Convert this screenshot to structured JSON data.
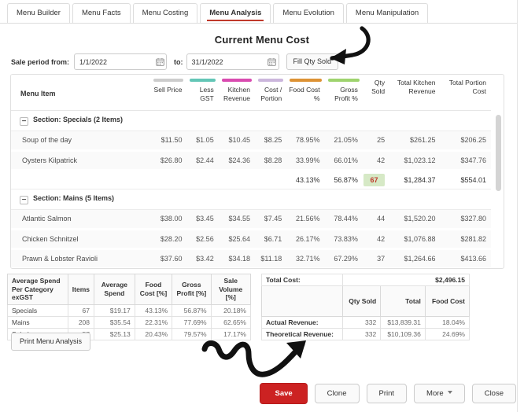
{
  "tabs": [
    {
      "label": "Menu Builder",
      "active": false
    },
    {
      "label": "Menu Facts",
      "active": false
    },
    {
      "label": "Menu Costing",
      "active": false
    },
    {
      "label": "Menu Analysis",
      "active": true
    },
    {
      "label": "Menu Evolution",
      "active": false
    },
    {
      "label": "Menu Manipulation",
      "active": false
    }
  ],
  "page_title": "Current Menu Cost",
  "filters": {
    "from_label": "Sale period from:",
    "from_value": "1/1/2022",
    "to_label": "to:",
    "to_value": "31/1/2022",
    "fill_qty_label": "Fill Qty Sold",
    "calendar_icon": "calendar-icon"
  },
  "grid": {
    "columns": [
      {
        "label": "Menu Item",
        "bar": ""
      },
      {
        "label": "Sell Price",
        "bar": "#cccccc"
      },
      {
        "label": "Less GST",
        "bar": "#63c6b6"
      },
      {
        "label": "Kitchen Revenue",
        "bar": "#d94bb0"
      },
      {
        "label": "Cost / Portion",
        "bar": "#cbb6dc"
      },
      {
        "label": "Food Cost %",
        "bar": "#dd9234"
      },
      {
        "label": "Gross Profit %",
        "bar": "#9ed36e"
      },
      {
        "label": "Qty Sold",
        "bar": ""
      },
      {
        "label": "Total Kitchen Revenue",
        "bar": ""
      },
      {
        "label": "Total Portion Cost",
        "bar": ""
      }
    ],
    "sections": [
      {
        "title": "Section: Specials (2 Items)",
        "collapse_glyph": "−",
        "rows": [
          {
            "name": "Soup of the day",
            "sell": "$11.50",
            "gst": "$1.05",
            "kitchen": "$10.45",
            "cost": "$8.25",
            "food": "78.95%",
            "gross": "21.05%",
            "qty": "25",
            "tkr": "$261.25",
            "tpc": "$206.25"
          },
          {
            "name": "Oysters Kilpatrick",
            "sell": "$26.80",
            "gst": "$2.44",
            "kitchen": "$24.36",
            "cost": "$8.28",
            "food": "33.99%",
            "gross": "66.01%",
            "qty": "42",
            "tkr": "$1,023.12",
            "tpc": "$347.76"
          }
        ],
        "total": {
          "name": "",
          "sell": "",
          "gst": "",
          "kitchen": "",
          "cost": "",
          "food": "43.13%",
          "gross": "56.87%",
          "qty": "67",
          "tkr": "$1,284.37",
          "tpc": "$554.01"
        }
      },
      {
        "title": "Section: Mains (5 Items)",
        "collapse_glyph": "−",
        "rows": [
          {
            "name": "Atlantic Salmon",
            "sell": "$38.00",
            "gst": "$3.45",
            "kitchen": "$34.55",
            "cost": "$7.45",
            "food": "21.56%",
            "gross": "78.44%",
            "qty": "44",
            "tkr": "$1,520.20",
            "tpc": "$327.80"
          },
          {
            "name": "Chicken Schnitzel",
            "sell": "$28.20",
            "gst": "$2.56",
            "kitchen": "$25.64",
            "cost": "$6.71",
            "food": "26.17%",
            "gross": "73.83%",
            "qty": "42",
            "tkr": "$1,076.88",
            "tpc": "$281.82"
          },
          {
            "name": "Prawn & Lobster Ravioli",
            "sell": "$37.60",
            "gst": "$3.42",
            "kitchen": "$34.18",
            "cost": "$11.18",
            "food": "32.71%",
            "gross": "67.29%",
            "qty": "37",
            "tkr": "$1,264.66",
            "tpc": "$413.66"
          }
        ],
        "total": null
      }
    ]
  },
  "left_summary": {
    "headers": [
      "Average Spend Per Category exGST",
      "Items",
      "Average Spend",
      "Food Cost [%]",
      "Gross Profit [%]",
      "Sale Volume [%]"
    ],
    "rows": [
      {
        "cat": "Specials",
        "items": "67",
        "spend": "$19.17",
        "food": "43.13%",
        "gross": "56.87%",
        "vol": "20.18%"
      },
      {
        "cat": "Mains",
        "items": "208",
        "spend": "$35.54",
        "food": "22.31%",
        "gross": "77.69%",
        "vol": "62.65%"
      },
      {
        "cat": "Salads",
        "items": "57",
        "spend": "$25.13",
        "food": "20.43%",
        "gross": "79.57%",
        "vol": "17.17%"
      }
    ]
  },
  "right_summary": {
    "total_cost_label": "Total Cost:",
    "total_cost_value": "$2,496.15",
    "headers": [
      "",
      "Qty Sold",
      "Total",
      "Food Cost"
    ],
    "rows": [
      {
        "label": "Actual Revenue:",
        "qty": "332",
        "total": "$13,839.31",
        "food": "18.04%"
      },
      {
        "label": "Theoretical Revenue:",
        "qty": "332",
        "total": "$10,109.36",
        "food": "24.69%"
      }
    ]
  },
  "print_button_label": "Print Menu Analysis",
  "footer": {
    "save": "Save",
    "clone": "Clone",
    "print": "Print",
    "more": "More",
    "close": "Close",
    "more_icon": "chevron-down-icon"
  },
  "annotations": [
    {
      "name": "arrow-to-fill-qty-sold",
      "shape": "curved-arrow-left"
    },
    {
      "name": "arrow-to-save-button",
      "shape": "squiggle-arrow-up-right"
    }
  ],
  "colors": {
    "accent_red": "#cc2222",
    "tab_underline": "#c0392b",
    "highlight_green": "#d6e9c6",
    "highlight_text": "#c0392b"
  }
}
